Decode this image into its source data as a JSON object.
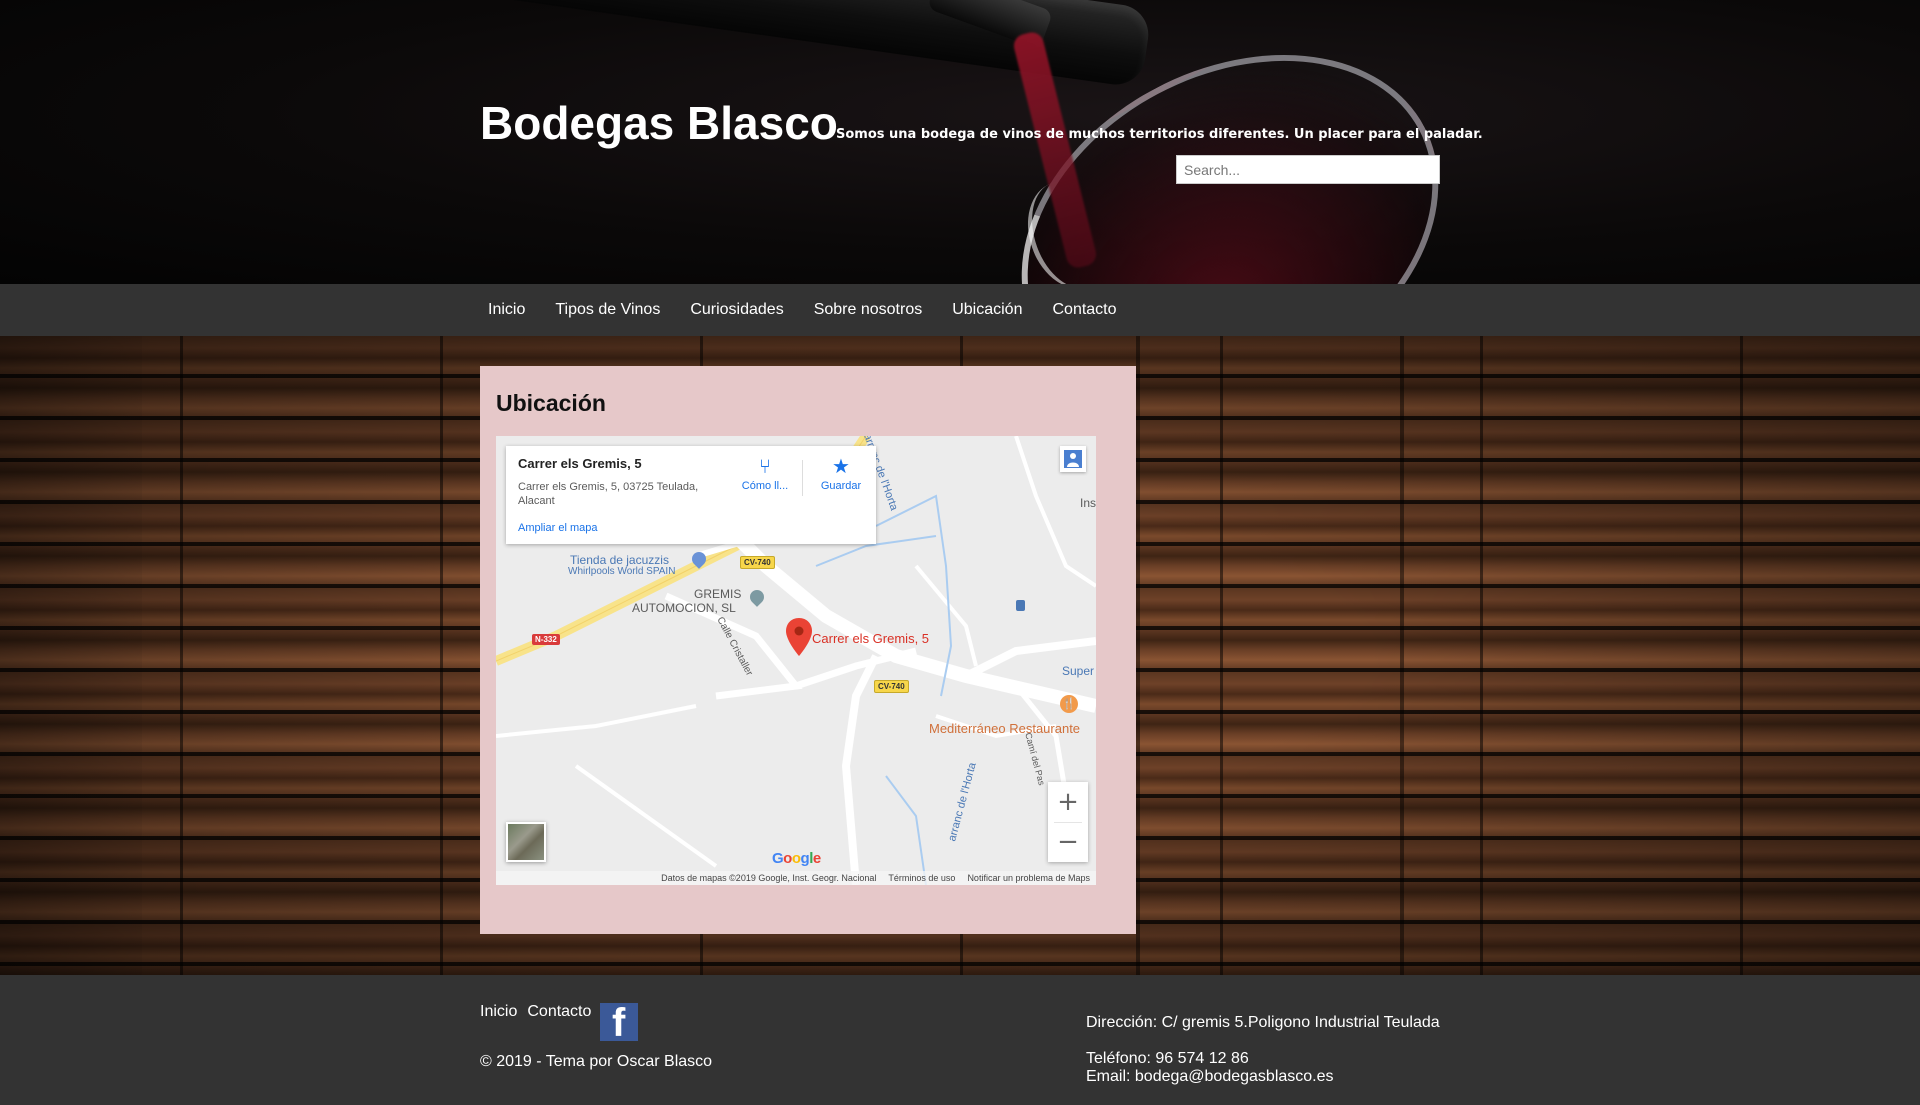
{
  "header": {
    "site_title": "Bodegas Blasco",
    "tagline": "Somos una bodega de vinos de muchos territorios diferentes. Un placer para el paladar.",
    "search_placeholder": "Search..."
  },
  "nav": {
    "items": [
      {
        "label": "Inicio"
      },
      {
        "label": "Tipos de Vinos"
      },
      {
        "label": "Curiosidades"
      },
      {
        "label": "Sobre nosotros"
      },
      {
        "label": "Ubicación"
      },
      {
        "label": "Contacto"
      }
    ]
  },
  "main": {
    "title": "Ubicación",
    "map": {
      "place_name": "Carrer els Gremis, 5",
      "place_address": "Carrer els Gremis, 5, 03725 Teulada, Alacant",
      "enlarge_link": "Ampliar el mapa",
      "directions_label": "Cómo ll...",
      "save_label": "Guardar",
      "labels": {
        "pin_label": "Carrer els Gremis, 5",
        "poi_jacuzzis": "Tienda de jacuzzis",
        "poi_jacuzzis_sub": "Whirlpools World SPAIN",
        "poi_gremis_1": "GREMIS",
        "poi_gremis_2": "AUTOMOCION, SL",
        "street_cristaller": "Calle Cristaller",
        "street_horta_top": "arranc de l'Horta",
        "street_horta_bottom": "arranc de l'Horta",
        "street_pas": "Camí del Pas",
        "poi_restaurant": "Mediterráneo Restaurante",
        "poi_super": "Super",
        "poi_ins": "Ins",
        "road_cv740_a": "CV-740",
        "road_cv740_b": "CV-740",
        "road_n332": "N-332"
      },
      "google_logo": "Google",
      "footer": {
        "map_data": "Datos de mapas ©2019 Google, Inst. Geogr. Nacional",
        "terms": "Términos de uso",
        "report": "Notificar un problema de Maps"
      }
    }
  },
  "footer": {
    "links": [
      {
        "label": "Inicio"
      },
      {
        "label": "Contacto"
      }
    ],
    "copyright": "© 2019 - Tema por Oscar Blasco",
    "address": "Dirección: C/ gremis 5.Poligono Industrial Teulada",
    "phone": "Teléfono: 96 574 12 86",
    "email": "Email: bodega@bodegasblasco.es"
  },
  "colors": {
    "nav_bg": "#333333",
    "content_bg": "#e6c8c9",
    "link_blue": "#1a73e8",
    "pin_red": "#d93025",
    "facebook_blue": "#3b5998"
  },
  "icons": {
    "directions": "directions-icon",
    "save": "star-icon",
    "pin": "map-pin-icon",
    "street_view": "pegman-icon",
    "facebook": "facebook-icon"
  }
}
